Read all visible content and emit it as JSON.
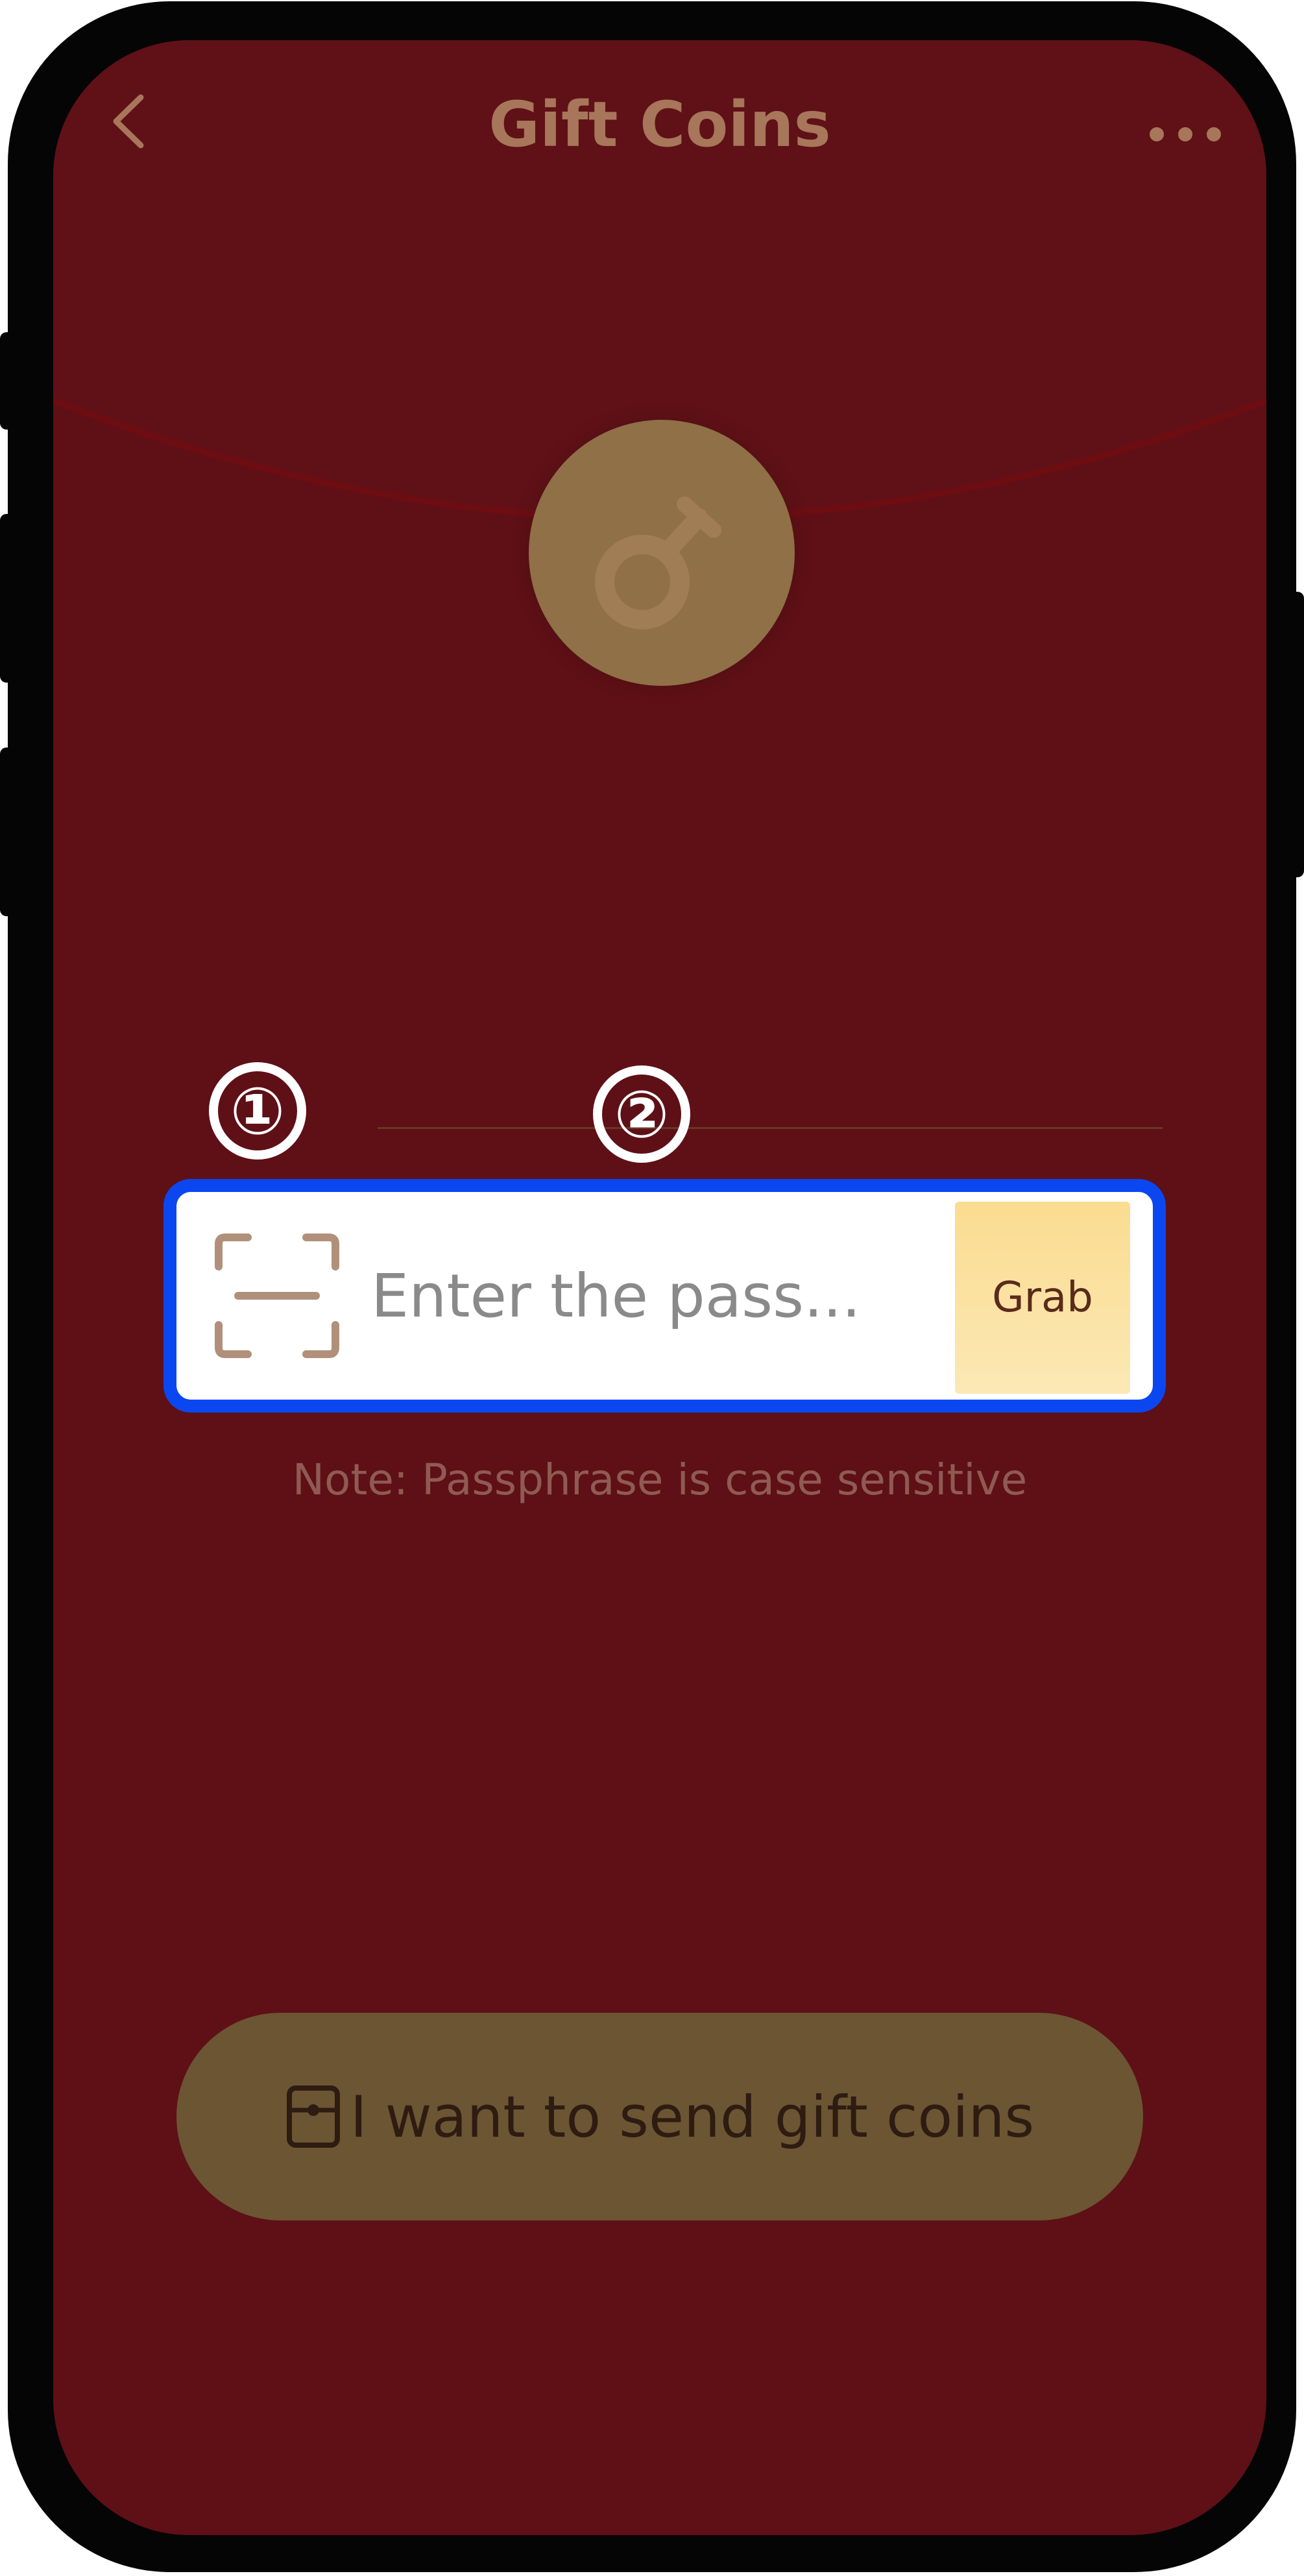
{
  "header": {
    "title": "Gift Coins",
    "back_icon": "chevron-left-icon",
    "more_icon": "more-horizontal-icon"
  },
  "annotations": {
    "marker_1": "①",
    "marker_2": "②"
  },
  "passphrase": {
    "scan_icon": "scan-icon",
    "placeholder": "Enter the pass...",
    "value": "",
    "grab_label": "Grab",
    "note": "Note: Passphrase is case sensitive"
  },
  "send": {
    "icon": "red-envelope-icon",
    "label": "I want to send gift coins"
  },
  "colors": {
    "background": "#5e1016",
    "highlight_border": "#0b47f1",
    "accent_gold": "#907047",
    "grab_button": "#fbdc90",
    "send_button": "#6b5533"
  }
}
